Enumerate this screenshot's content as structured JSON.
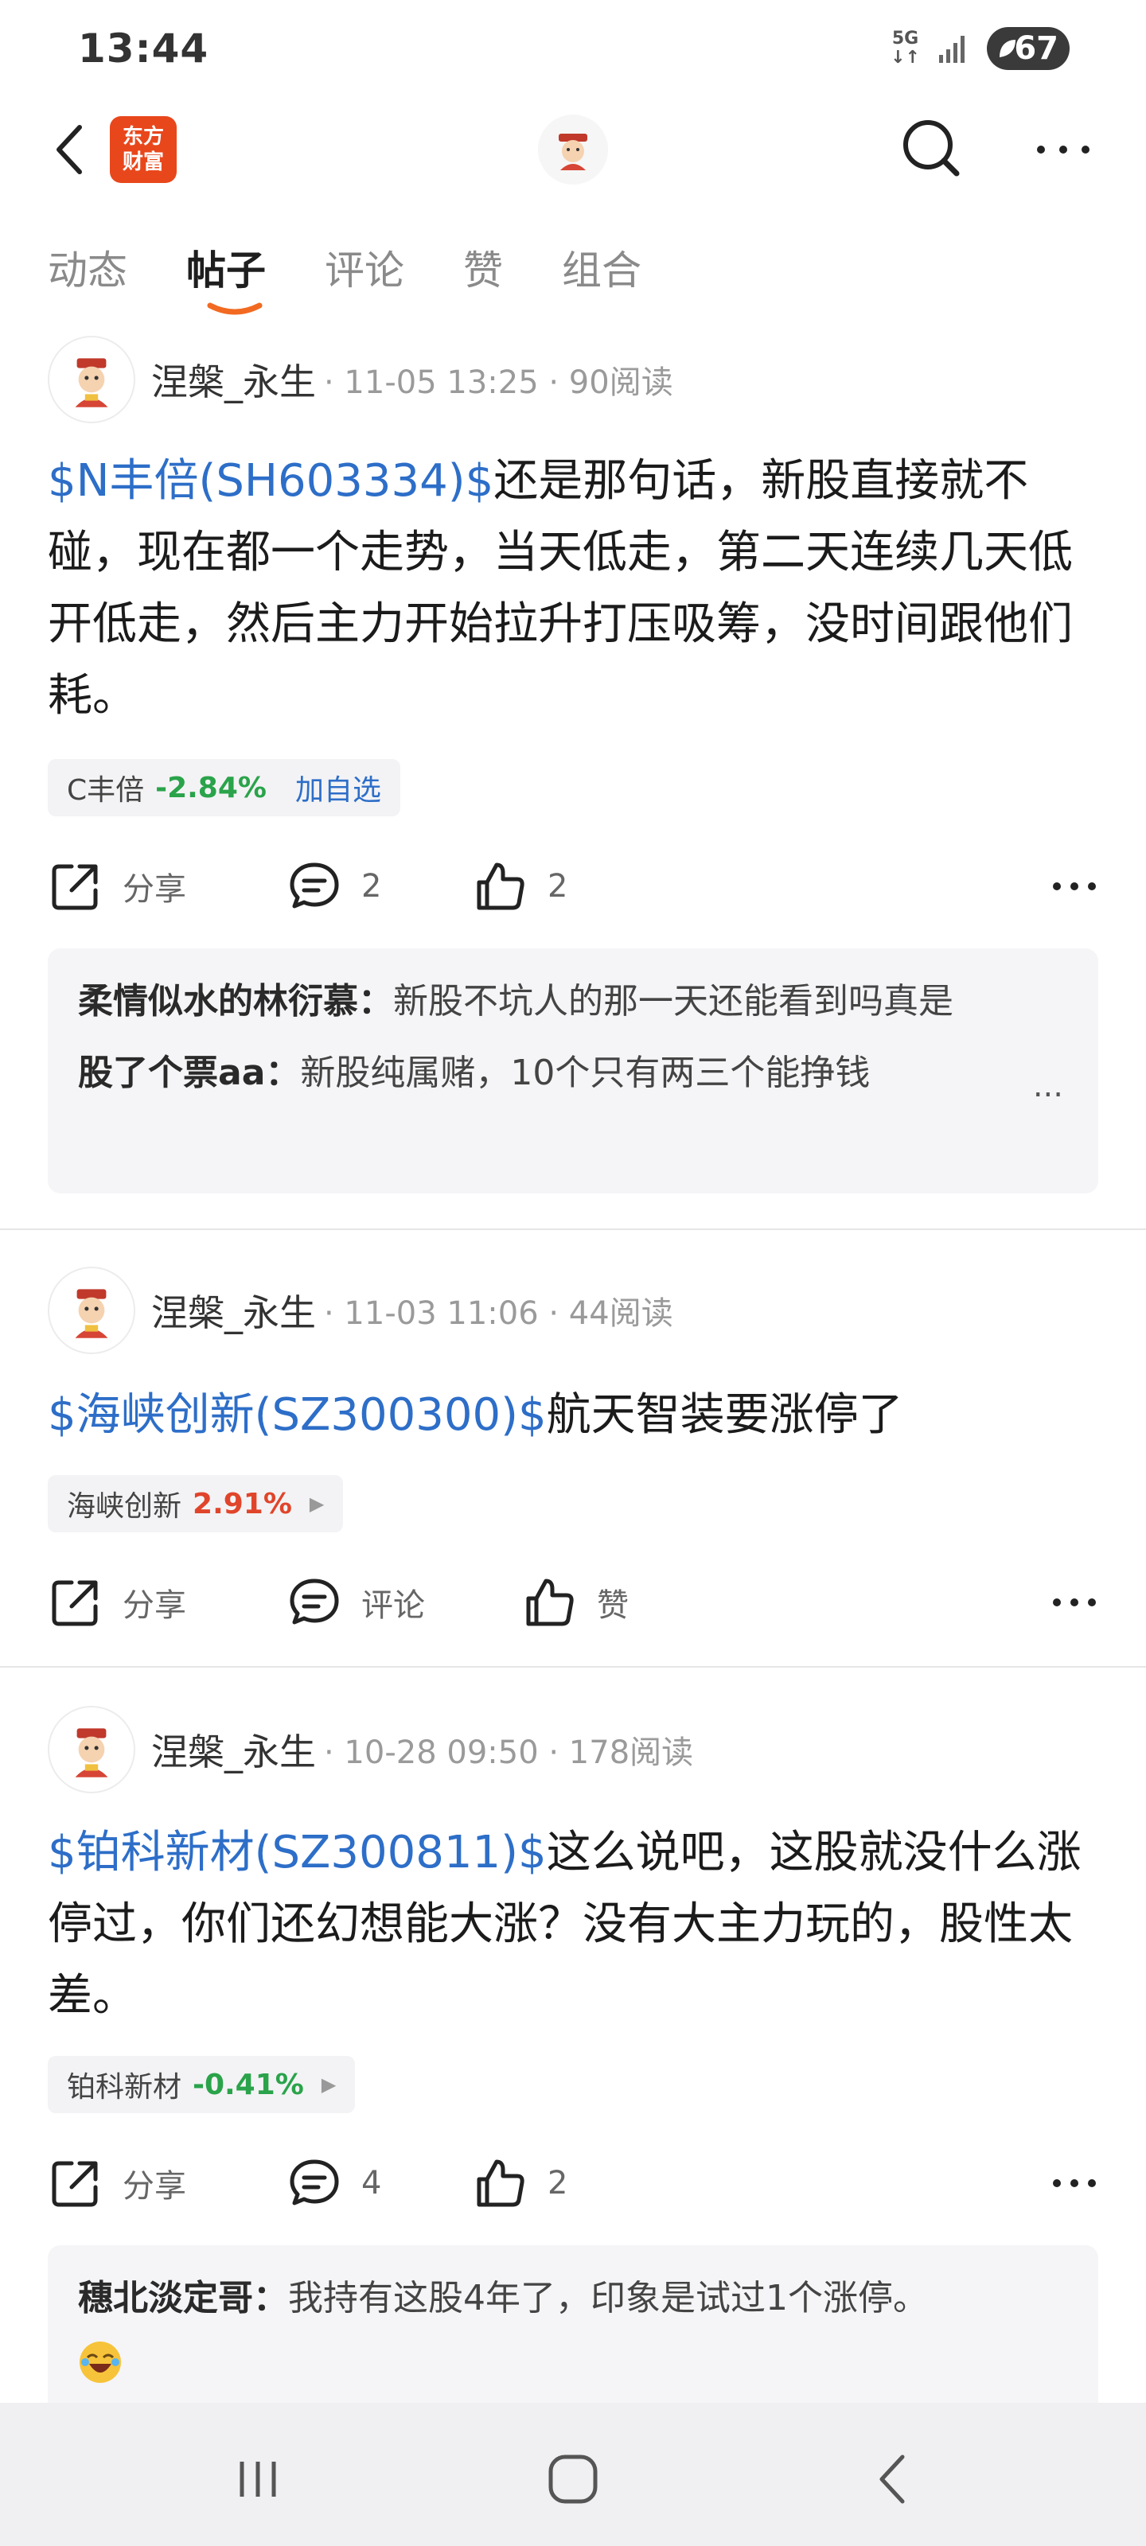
{
  "status_bar": {
    "time": "13:44",
    "network": "5G",
    "battery": "67"
  },
  "top_nav": {
    "brand": [
      "东方",
      "财富"
    ]
  },
  "tabs": [
    {
      "label": "动态",
      "active": false
    },
    {
      "label": "帖子",
      "active": true
    },
    {
      "label": "评论",
      "active": false
    },
    {
      "label": "赞",
      "active": false
    },
    {
      "label": "组合",
      "active": false
    }
  ],
  "posts": [
    {
      "author": "涅槃_永生",
      "meta": "· 11-05 13:25 · 90阅读",
      "stock_tag": "$N丰倍(SH603334)$",
      "text": "还是那句话，新股直接就不碰，现在都一个走势，当天低走，第二天连续几天低开低走，然后主力开始拉升打压吸筹，没时间跟他们耗。",
      "chip_name": "C丰倍",
      "chip_change": "-2.84%",
      "chip_action": "加自选",
      "share_label": "分享",
      "comment_count": "2",
      "like_count": "2",
      "comments": [
        {
          "name": "柔情似水的林衍慕：",
          "text": "新股不坑人的那一天还能看到吗真是"
        },
        {
          "name": "股了个票aa：",
          "text": "新股纯属赌，10个只有两三个能挣钱"
        }
      ],
      "comments_more": "..."
    },
    {
      "author": "涅槃_永生",
      "meta": "· 11-03 11:06 · 44阅读",
      "stock_tag": "$海峡创新(SZ300300)$",
      "text": "航天智装要涨停了",
      "chip_name": "海峡创新",
      "chip_change": "2.91%",
      "share_label": "分享",
      "comment_label": "评论",
      "like_label": "赞"
    },
    {
      "author": "涅槃_永生",
      "meta": "· 10-28 09:50 · 178阅读",
      "stock_tag": "$铂科新材(SZ300811)$",
      "text": "这么说吧，这股就没什么涨停过，你们还幻想能大涨？没有大主力玩的，股性太差。",
      "chip_name": "铂科新材",
      "chip_change": "-0.41%",
      "share_label": "分享",
      "comment_count": "4",
      "like_count": "2",
      "comments": [
        {
          "name": "穗北淡定哥：",
          "text": "我持有这股4年了，印象是试过1个涨停。"
        }
      ]
    }
  ],
  "colors": {
    "link": "#2d6ec8",
    "down": "#2aa34a",
    "up": "#e0452b",
    "accent": "#f26a21"
  }
}
